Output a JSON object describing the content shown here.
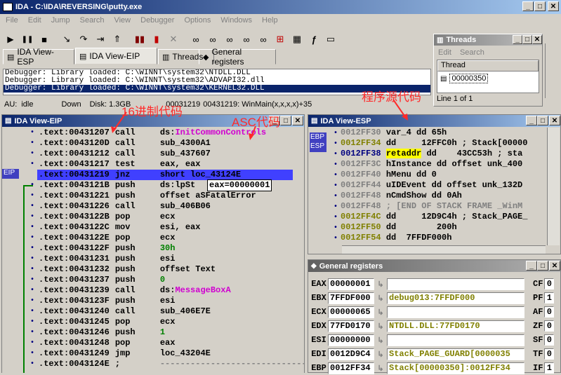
{
  "app": {
    "title": "IDA - C:\\IDA\\REVERSING\\putty.exe",
    "menu": [
      "File",
      "Edit",
      "Jump",
      "Search",
      "View",
      "Debugger",
      "Options",
      "Windows",
      "Help"
    ]
  },
  "toolbar": {
    "run": "▶",
    "pause": "❚❚",
    "stop": "■",
    "icons": [
      "▮▮",
      "▮",
      "✕",
      "▭▭",
      "▭▭",
      "▭▭",
      "▭▭",
      "▭▭",
      "⊞",
      "▦",
      "ƒ",
      "▭"
    ]
  },
  "tabs": [
    {
      "label": "IDA View-ESP"
    },
    {
      "label": "IDA View-EIP"
    },
    {
      "label": "Threads"
    },
    {
      "label": "General registers"
    }
  ],
  "output": {
    "lines": [
      "Debugger: Library loaded: C:\\WINNT\\system32\\NTDLL.DLL",
      "Debugger: Library loaded: C:\\WINNT\\system32\\ADVAPI32.dll",
      "Debugger: Library loaded: C:\\WINNT\\system32\\KERNEL32.DLL"
    ]
  },
  "status": {
    "au": "AU:",
    "state": "idle",
    "dir": "Down",
    "disk": "Disk: 1.3GB",
    "addr": "00031219",
    "loc": "00431219: WinMain(x,x,x,x)+35"
  },
  "threads_win": {
    "title": "Threads",
    "menu": [
      "Edit",
      "Search"
    ],
    "header": "Thread",
    "row": "00000350",
    "footer": "Line 1 of 1"
  },
  "eip_view": {
    "title": "IDA View-EIP",
    "eip_label": "EIP",
    "tooltip": "eax=00000001",
    "lines": [
      {
        "addr": ".text:00431207",
        "op": "call",
        "arg": "ds:",
        "arg2": "InitCommonControls",
        "c2": "mag"
      },
      {
        "addr": ".text:0043120D",
        "op": "call",
        "arg": "sub_4300A1"
      },
      {
        "addr": ".text:00431212",
        "op": "call",
        "arg": "sub_437607"
      },
      {
        "addr": ".text:00431217",
        "op": "test",
        "arg": "eax, eax"
      },
      {
        "addr": ".text:00431219",
        "op": "jnz",
        "arg": "short loc_43124E",
        "hl": true
      },
      {
        "addr": ".text:0043121B",
        "op": "push",
        "arg": "ds:lpSt"
      },
      {
        "addr": ".text:00431221",
        "op": "push",
        "arg": "offset aSFatalError"
      },
      {
        "addr": ".text:00431226",
        "op": "call",
        "arg": "sub_406B06"
      },
      {
        "addr": ".text:0043122B",
        "op": "pop",
        "arg": "ecx"
      },
      {
        "addr": ".text:0043122C",
        "op": "mov",
        "arg": "esi, eax"
      },
      {
        "addr": ".text:0043122E",
        "op": "pop",
        "arg": "ecx"
      },
      {
        "addr": ".text:0043122F",
        "op": "push",
        "arg": "30h",
        "c": "green"
      },
      {
        "addr": ".text:00431231",
        "op": "push",
        "arg": "esi"
      },
      {
        "addr": ".text:00431232",
        "op": "push",
        "arg": "offset Text"
      },
      {
        "addr": ".text:00431237",
        "op": "push",
        "arg": "0",
        "c": "green"
      },
      {
        "addr": ".text:00431239",
        "op": "call",
        "arg": "ds:",
        "arg2": "MessageBoxA",
        "c2": "mag"
      },
      {
        "addr": ".text:0043123F",
        "op": "push",
        "arg": "esi"
      },
      {
        "addr": ".text:00431240",
        "op": "call",
        "arg": "sub_406E7E"
      },
      {
        "addr": ".text:00431245",
        "op": "pop",
        "arg": "ecx"
      },
      {
        "addr": ".text:00431246",
        "op": "push",
        "arg": "1",
        "c": "green"
      },
      {
        "addr": ".text:00431248",
        "op": "pop",
        "arg": "eax"
      },
      {
        "addr": ".text:00431249",
        "op": "jmp",
        "arg": "loc_43204E"
      },
      {
        "addr": ".text:0043124E",
        "op": ";",
        "arg": "---------------------------------------",
        "c": "grey"
      }
    ]
  },
  "esp_view": {
    "title": "IDA View-ESP",
    "ebp": "EBP",
    "esp": "ESP",
    "lines": [
      {
        "addr": "0012FF30",
        "rest": "var_4 dd 65h",
        "ac": "grey"
      },
      {
        "addr": "0012FF34",
        "rest": "dd     12FFC0h ; Stack[00000",
        "ac": "olive"
      },
      {
        "addr": "0012FF38",
        "rest": "retaddr",
        "rest2": " dd    43CC53h ; sta",
        "ac": "blue",
        "yl": true
      },
      {
        "addr": "0012FF3C",
        "rest": "hInstance dd offset unk_400",
        "ac": "grey"
      },
      {
        "addr": "0012FF40",
        "rest": "hMenu dd 0",
        "ac": "grey"
      },
      {
        "addr": "0012FF44",
        "rest": "uIDEvent dd offset unk_132D",
        "ac": "grey"
      },
      {
        "addr": "0012FF48",
        "rest": "nCmdShow dd 0Ah",
        "ac": "grey"
      },
      {
        "addr": "0012FF48",
        "rest": "; [END OF STACK FRAME _WinM",
        "ac": "grey",
        "cmt": true
      },
      {
        "addr": "0012FF4C",
        "rest": "dd     12D9C4h ; Stack_PAGE_",
        "ac": "olive"
      },
      {
        "addr": "0012FF50",
        "rest": "dd        200h",
        "ac": "olive"
      },
      {
        "addr": "0012FF54",
        "rest": "dd  7FFDF000h",
        "ac": "olive"
      }
    ]
  },
  "registers": {
    "title": "General registers",
    "rows": [
      {
        "name": "EAX",
        "val": "00000001",
        "desc": "",
        "flag": "CF",
        "fv": "0"
      },
      {
        "name": "EBX",
        "val": "7FFDF000",
        "desc": "debug013:7FFDF000",
        "flag": "PF",
        "fv": "1"
      },
      {
        "name": "ECX",
        "val": "00000065",
        "desc": "",
        "flag": "AF",
        "fv": "0"
      },
      {
        "name": "EDX",
        "val": "77FD0170",
        "desc": "NTDLL.DLL:77FD0170",
        "flag": "ZF",
        "fv": "0"
      },
      {
        "name": "ESI",
        "val": "00000000",
        "desc": "",
        "flag": "SF",
        "fv": "0"
      },
      {
        "name": "EDI",
        "val": "0012D9C4",
        "desc": "Stack_PAGE_GUARD[0000035",
        "flag": "TF",
        "fv": "0"
      },
      {
        "name": "EBP",
        "val": "0012FF34",
        "desc": "Stack[00000350]:0012FF34",
        "flag": "IF",
        "fv": "1"
      }
    ]
  },
  "annotations": {
    "hex": "16进制代码",
    "asc": "ASC代码",
    "src": "程序源代码"
  },
  "colors": {
    "accent": "#0a246a",
    "annot": "#ff2a2a"
  }
}
